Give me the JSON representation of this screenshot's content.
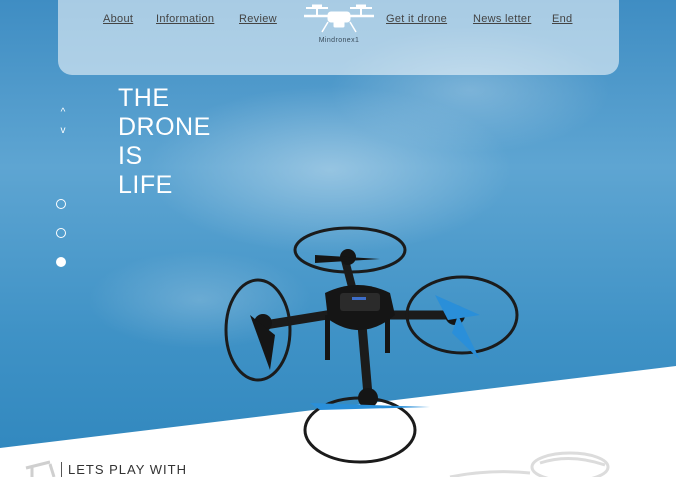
{
  "nav": {
    "links_left": [
      "About",
      "Information",
      "Review"
    ],
    "links_right": [
      "Get it drone",
      "News letter",
      "End"
    ],
    "logo_text": "Mindronex1"
  },
  "hero": {
    "headline": [
      "THE",
      "DRONE",
      "IS",
      "LIFE"
    ],
    "arrow_up": "^",
    "arrow_down": "v",
    "dots": {
      "count": 3,
      "active_index": 2
    }
  },
  "footer_peek": {
    "text": "LETS PLAY WITH"
  },
  "icons": [
    "drone-logo-icon",
    "chevron-up-icon",
    "chevron-down-icon",
    "drone-image"
  ],
  "colors": {
    "sky": "#4b9acb",
    "white": "#ffffff",
    "nav_text": "#444444"
  }
}
